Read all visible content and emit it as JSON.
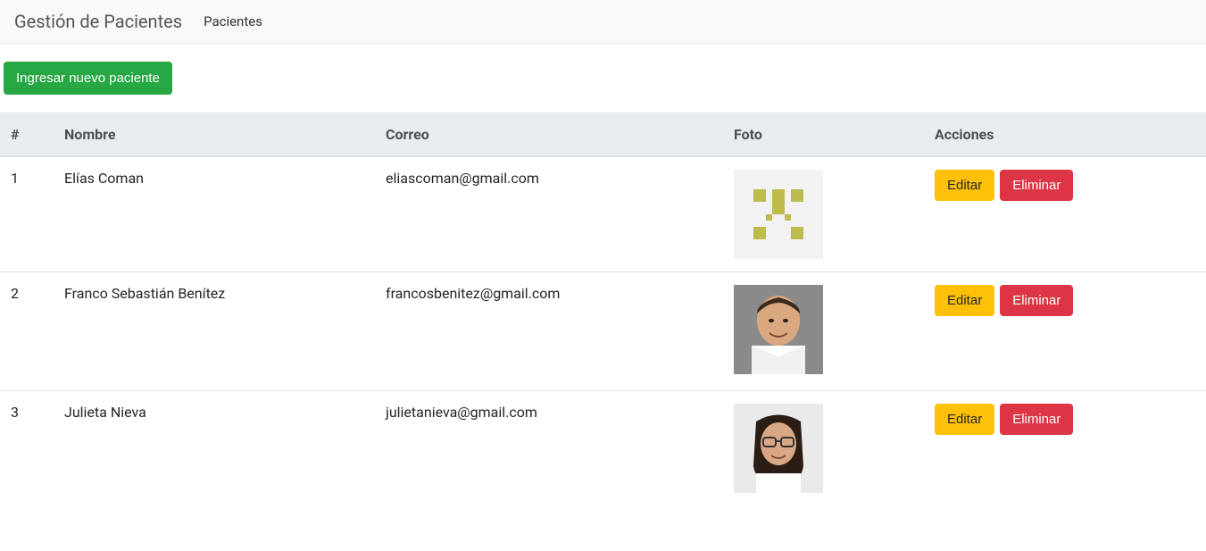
{
  "navbar": {
    "brand": "Gestión de Pacientes",
    "link_pacientes": "Pacientes"
  },
  "buttons": {
    "new_patient": "Ingresar nuevo paciente",
    "edit": "Editar",
    "delete": "Eliminar"
  },
  "table": {
    "headers": {
      "index": "#",
      "name": "Nombre",
      "email": "Correo",
      "photo": "Foto",
      "actions": "Acciones"
    },
    "rows": [
      {
        "index": "1",
        "name": "Elías Coman",
        "email": "eliascoman@gmail.com",
        "photo_type": "identicon"
      },
      {
        "index": "2",
        "name": "Franco Sebastián Benítez",
        "email": "francosbenitez@gmail.com",
        "photo_type": "person1"
      },
      {
        "index": "3",
        "name": "Julieta Nieva",
        "email": "julietanieva@gmail.com",
        "photo_type": "person2"
      }
    ]
  }
}
